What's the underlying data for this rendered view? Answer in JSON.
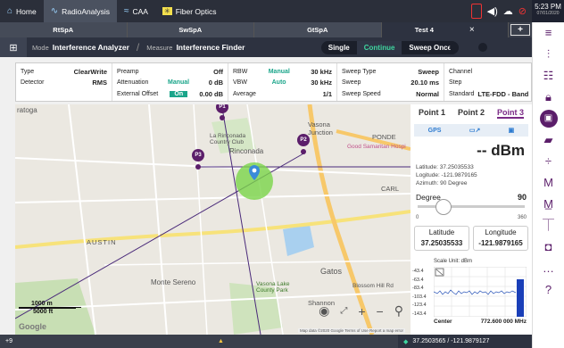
{
  "topbar": {
    "home": "Home",
    "app": "RadioAnalysis",
    "caa": "CAA",
    "fiber": "Fiber Optics",
    "time": "5:23 PM",
    "date": "07/01/2020"
  },
  "tabs": [
    "RtSpA",
    "SwSpA",
    "GtSpA",
    "Test 4"
  ],
  "mode": {
    "mode_label": "Mode",
    "mode_value": "Interference Analyzer",
    "measure_label": "Measure",
    "measure_value": "Interference Finder",
    "single": "Single",
    "continue": "Continue",
    "sweep_once": "Sweep Once"
  },
  "params": {
    "type_label": "Type",
    "type_value": "ClearWrite",
    "detector_label": "Detector",
    "detector_value": "RMS",
    "preamp_label": "Preamp",
    "preamp_value": "Off",
    "atten_label": "Attenuation",
    "atten_mode": "Manual",
    "atten_value": "0 dB",
    "extoff_label": "External Offset",
    "extoff_mode": "On",
    "extoff_value": "0.00 dB",
    "rbw_label": "RBW",
    "rbw_mode": "Manual",
    "rbw_value": "30 kHz",
    "vbw_label": "VBW",
    "vbw_mode": "Auto",
    "vbw_value": "30 kHz",
    "avg_label": "Average",
    "avg_value": "1/1",
    "sweeptype_label": "Sweep Type",
    "sweeptype_value": "Sweep",
    "sweep_label": "Sweep",
    "sweep_value": "20.10 ms",
    "sweepspeed_label": "Sweep Speed",
    "sweepspeed_value": "Normal",
    "channel_label": "Channel",
    "step_label": "Step",
    "standard_label": "Standard",
    "standard_value": "LTE-FDD - Band"
  },
  "map": {
    "labels": {
      "saratoga": "ratoga",
      "laronciada": "La Rinconada Country Club",
      "rinconada": "Rinconada",
      "vasona": "Vasona Junction",
      "austin": "AUSTIN",
      "monte": "Monte Sereno",
      "vasonalake": "Vasona Lake County Park",
      "shannon": "Shannon",
      "gatos": "Gatos",
      "carl": "CARL",
      "ponde": "PONDE",
      "goodsam": "Good Samaritan Hospi",
      "blossom": "Blossom Hill Rd"
    },
    "pins": [
      "P1",
      "P2",
      "P3"
    ],
    "scale_m": "1000 m",
    "scale_ft": "5000 ft",
    "google": "Google",
    "attribution": "Map data ©2020 Google   Terms of Use   Report a map error"
  },
  "panel": {
    "tabs": [
      "Point 1",
      "Point 2",
      "Point 3"
    ],
    "gps": "GPS",
    "reading": "-- dBm",
    "latitude_line": "Latitude: 37.25035533",
    "longitude_line": "Logitude: -121.9879165",
    "azimuth_line": "Azimuth: 90 Degree",
    "degree_label": "Degree",
    "degree_value": "90",
    "degree_min": "0",
    "degree_max": "360",
    "lat_label": "Latitude",
    "lat_value": "37.25035533",
    "lon_label": "Longitude",
    "lon_value": "-121.9879165"
  },
  "spectrum": {
    "title": "Scale Unit: dBm",
    "yticks": [
      "-43.4",
      "-63.4",
      "-83.4",
      "-103.4",
      "-123.4",
      "-143.4"
    ],
    "center_label": "Center",
    "center_value": "772.600 000 MHz"
  },
  "bottom": {
    "left": "+9",
    "warning": "▲",
    "gps": "37.2503565 / -121.9879127"
  }
}
